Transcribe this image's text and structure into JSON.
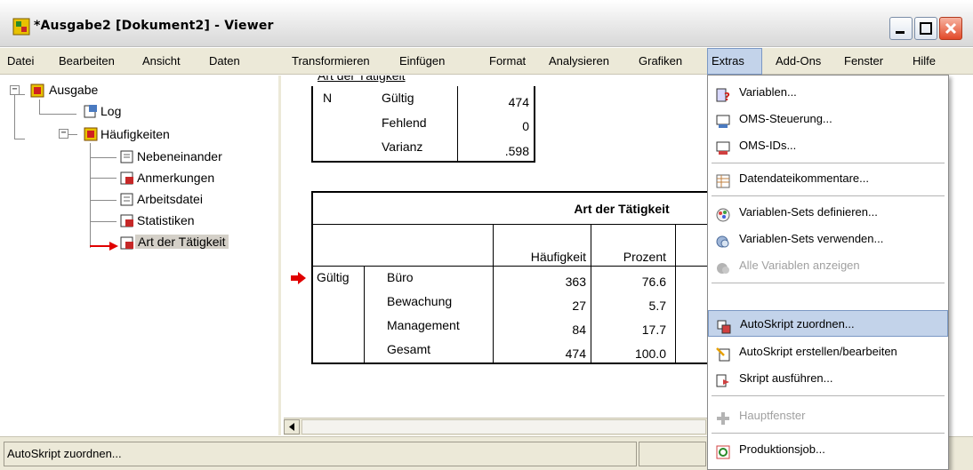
{
  "window": {
    "title": "*Ausgabe2 [Dokument2] - Viewer",
    "minimize_label": "_",
    "maximize_label": "□",
    "close_label": "✕"
  },
  "menubar": [
    "Datei",
    "Bearbeiten",
    "Ansicht",
    "Daten",
    "Transformieren",
    "Einfügen",
    "Format",
    "Analysieren",
    "Grafiken",
    "Extras",
    "Add-Ons",
    "Fenster",
    "Hilfe"
  ],
  "tree": {
    "root": "Ausgabe",
    "log": "Log",
    "group": "Häufigkeiten",
    "children": [
      "Nebeneinander",
      "Anmerkungen",
      "Arbeitsdatei",
      "Statistiken",
      "Art der Tätigkeit"
    ]
  },
  "stats_table": {
    "caption": "Art der Tätigkeit",
    "row_header": "N",
    "rows": [
      {
        "label": "Gültig",
        "value": "474"
      },
      {
        "label": "Fehlend",
        "value": "0"
      },
      {
        "label": "Varianz",
        "value": ".598"
      }
    ]
  },
  "freq_table": {
    "title": "Art der Tätigkeit",
    "headers": [
      "Häufigkeit",
      "Prozent"
    ],
    "group": "Gültig",
    "rows": [
      {
        "label": "Büro",
        "freq": "363",
        "pct": "76.6"
      },
      {
        "label": "Bewachung",
        "freq": "27",
        "pct": "5.7"
      },
      {
        "label": "Management",
        "freq": "84",
        "pct": "17.7"
      },
      {
        "label": "Gesamt",
        "freq": "474",
        "pct": "100.0"
      }
    ]
  },
  "extras_menu": [
    {
      "label": "Variablen...",
      "icon": "variables-icon"
    },
    {
      "label": "OMS-Steuerung...",
      "icon": "oms-control-icon"
    },
    {
      "label": "OMS-IDs...",
      "icon": "oms-ids-icon"
    },
    {
      "label": "Datendateikommentare...",
      "icon": "data-file-comments-icon"
    },
    {
      "label": "Variablen-Sets definieren...",
      "icon": "define-sets-icon"
    },
    {
      "label": "Variablen-Sets verwenden...",
      "icon": "use-sets-icon"
    },
    {
      "label": "Alle Variablen anzeigen",
      "icon": "show-all-icon"
    },
    {
      "label": "AutoSkript zuordnen...",
      "icon": "assign-autoscript-icon"
    },
    {
      "label": "AutoSkript erstellen/bearbeiten",
      "icon": "edit-autoscript-icon"
    },
    {
      "label": "Skript ausführen...",
      "icon": "run-script-icon"
    },
    {
      "label": "Hauptfenster",
      "icon": "main-window-icon"
    },
    {
      "label": "Produktionsjob...",
      "icon": "production-job-icon"
    }
  ],
  "status": {
    "text": "AutoSkript zuordnen..."
  },
  "colors": {
    "accent": "#c3d3ea",
    "arrow": "#e00000",
    "menubar": "#ece9d8"
  }
}
